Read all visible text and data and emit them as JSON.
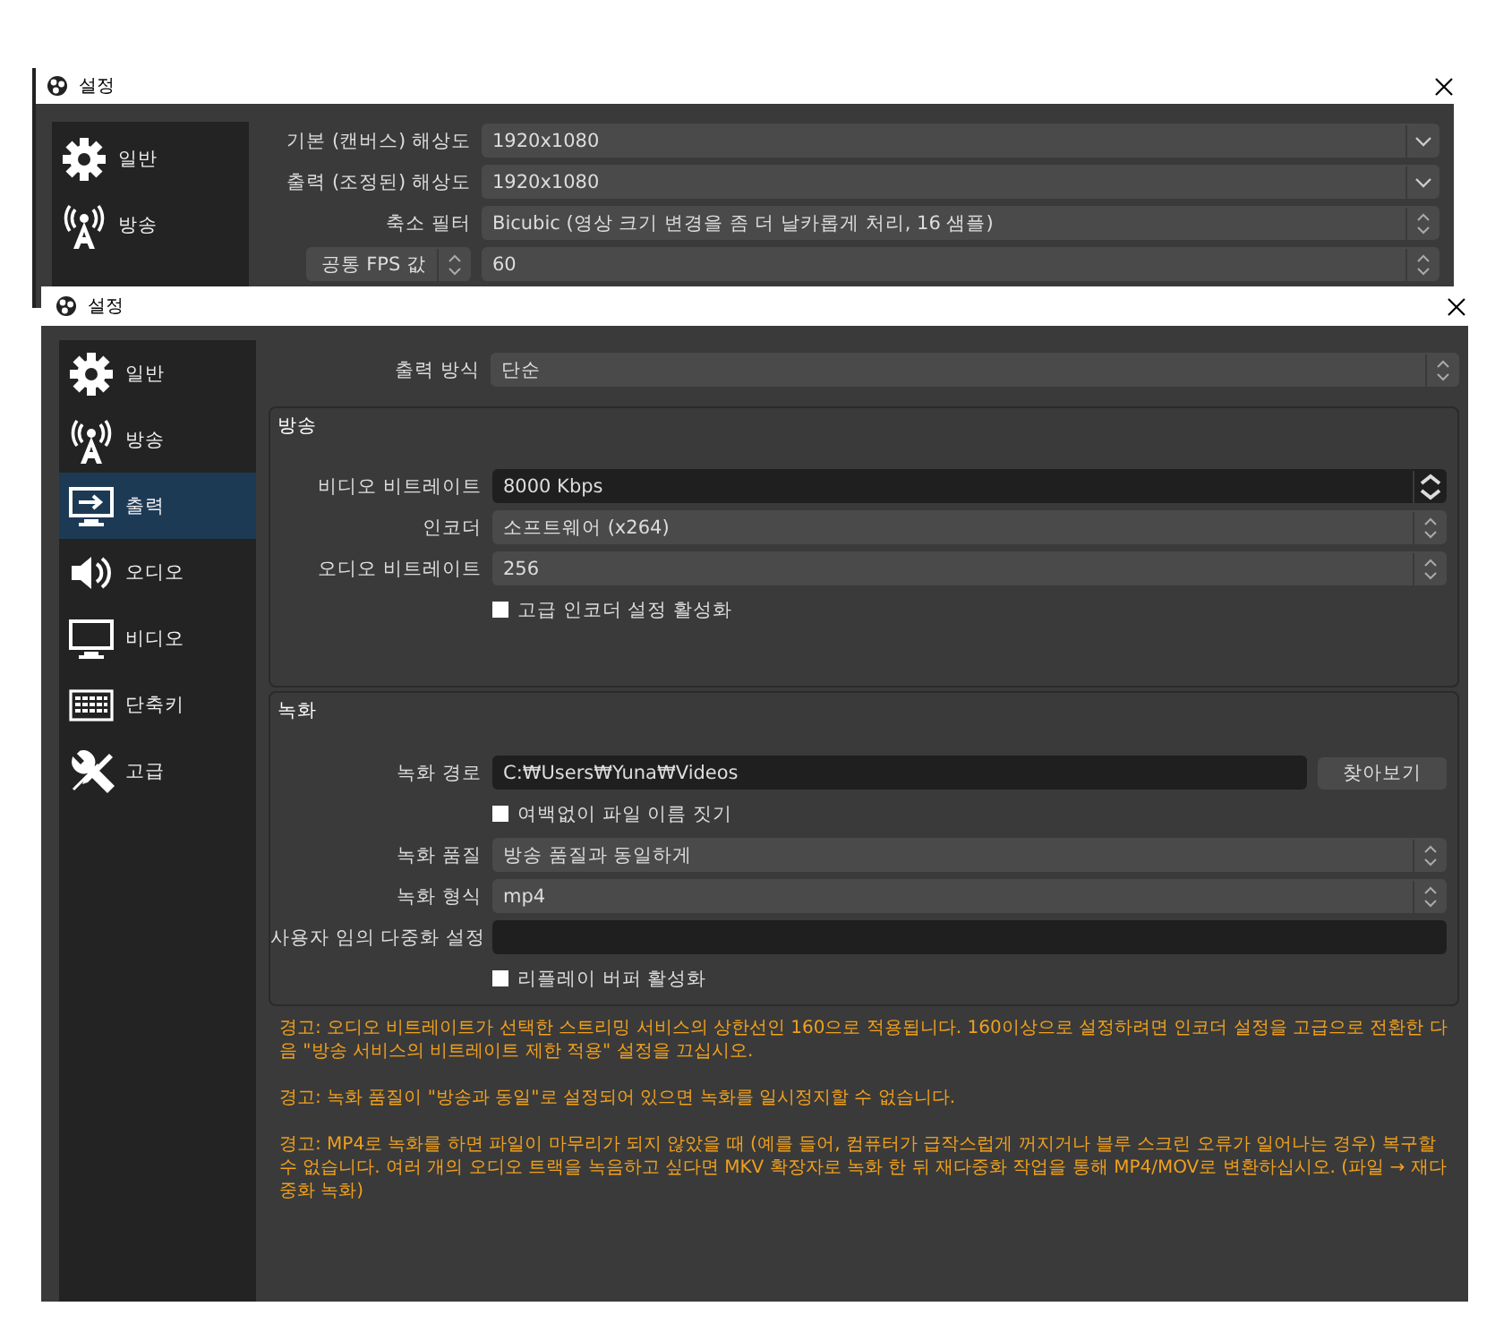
{
  "back_window": {
    "title": "설정",
    "sidebar": [
      {
        "label": "일반",
        "selected": false
      },
      {
        "label": "방송",
        "selected": false
      }
    ],
    "rows": [
      {
        "kind": "dropdown",
        "label": "기본 (캔버스) 해상도",
        "value": "1920x1080"
      },
      {
        "kind": "dropdown",
        "label": "출력 (조정된) 해상도",
        "value": "1920x1080"
      },
      {
        "kind": "combo",
        "label": "축소 필터",
        "value": "Bicubic (영상 크기 변경을 좀 더 날카롭게 처리, 16 샘플)"
      },
      {
        "kind": "fps",
        "label": "공통 FPS 값",
        "value": "60"
      }
    ]
  },
  "front_window": {
    "title": "설정",
    "sidebar": [
      {
        "label": "일반",
        "selected": false
      },
      {
        "label": "방송",
        "selected": false
      },
      {
        "label": "출력",
        "selected": true
      },
      {
        "label": "오디오",
        "selected": false
      },
      {
        "label": "비디오",
        "selected": false
      },
      {
        "label": "단축키",
        "selected": false
      },
      {
        "label": "고급",
        "selected": false
      }
    ],
    "top_row": {
      "kind": "combo",
      "label": "출력 방식",
      "value": "단순"
    },
    "groups": [
      {
        "title": "방송",
        "rows": [
          {
            "kind": "spin",
            "label": "비디오 비트레이트",
            "value": "8000 Kbps"
          },
          {
            "kind": "combo",
            "label": "인코더",
            "value": "소프트웨어 (x264)"
          },
          {
            "kind": "combo",
            "label": "오디오 비트레이트",
            "value": "256"
          },
          {
            "kind": "checkbox",
            "label": "고급 인코더 설정 활성화",
            "checked": false
          }
        ]
      },
      {
        "title": "녹화",
        "rows": [
          {
            "kind": "path",
            "label": "녹화 경로",
            "value": "C:₩Users₩Yuna₩Videos",
            "button": "찾아보기"
          },
          {
            "kind": "checkbox",
            "label": "여백없이 파일 이름 짓기",
            "checked": false
          },
          {
            "kind": "combo",
            "label": "녹화 품질",
            "value": "방송 품질과 동일하게"
          },
          {
            "kind": "combo",
            "label": "녹화 형식",
            "value": "mp4"
          },
          {
            "kind": "text",
            "label": "사용자 임의 다중화 설정"
          },
          {
            "kind": "checkbox",
            "label": "리플레이 버퍼 활성화",
            "checked": false
          }
        ]
      }
    ],
    "warnings": [
      "경고: 오디오 비트레이트가 선택한 스트리밍 서비스의 상한선인 160으로 적용됩니다. 160이상으로 설정하려면 인코더 설정을 고급으로 전환한 다음 \"방송 서비스의 비트레이트 제한 적용\" 설정을 끄십시오.",
      "경고: 녹화 품질이 \"방송과 동일\"로 설정되어 있으면 녹화를 일시정지할 수 없습니다.",
      "경고: MP4로 녹화를 하면 파일이 마무리가 되지 않았을 때 (예를 들어, 컴퓨터가 급작스럽게 꺼지거나 블루 스크린 오류가 일어나는 경우) 복구할 수 없습니다. 여러 개의 오디오 트랙을 녹음하고 싶다면 MKV 확장자로 녹화 한 뒤 재다중화 작업을 통해 MP4/MOV로 변환하십시오. (파일 → 재다중화 녹화)"
    ]
  }
}
